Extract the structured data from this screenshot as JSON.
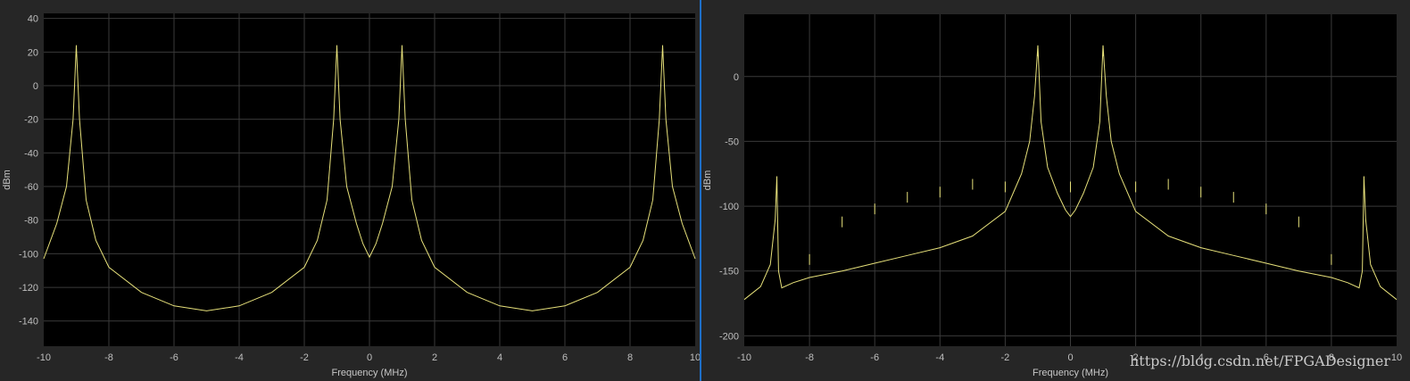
{
  "watermark": "https://blog.csdn.net/FPGADesigner",
  "colors": {
    "background": "#262626",
    "plot_background": "#000000",
    "trace": "#e6e07a",
    "grid": "#3a3a3a",
    "tick_text": "#bfbfbf",
    "divider": "#1e6fc8"
  },
  "chart_data": [
    {
      "type": "line",
      "xlabel": "Frequency (MHz)",
      "ylabel": "dBm",
      "xlim": [
        -10,
        10
      ],
      "ylim": [
        -155,
        43
      ],
      "xticks": [
        -10,
        -8,
        -6,
        -4,
        -2,
        0,
        2,
        4,
        6,
        8,
        10
      ],
      "yticks": [
        40,
        20,
        0,
        -20,
        -40,
        -60,
        -80,
        -100,
        -120,
        -140
      ],
      "grid": true,
      "floor": -134,
      "peaks": [
        {
          "x": -9,
          "y": 24
        },
        {
          "x": -1,
          "y": 24
        },
        {
          "x": 1,
          "y": 24
        },
        {
          "x": 9,
          "y": 24
        }
      ],
      "series": [
        {
          "x": [
            -10,
            -9.6,
            -9.3,
            -9.1,
            -9,
            -8.9,
            -8.7,
            -8.4,
            -8,
            -7,
            -6,
            -5,
            -4,
            -3,
            -2,
            -1.6,
            -1.3,
            -1.1,
            -1,
            -0.9,
            -0.7,
            -0.4,
            -0.2,
            0,
            0.2,
            0.4,
            0.7,
            0.9,
            1,
            1.1,
            1.3,
            1.6,
            2,
            3,
            4,
            5,
            6,
            7,
            8,
            8.4,
            8.7,
            8.9,
            9,
            9.1,
            9.3,
            9.6,
            10
          ],
          "values": [
            -103,
            -82,
            -60,
            -20,
            24,
            -20,
            -68,
            -92,
            -108,
            -123,
            -131,
            -134,
            -131,
            -123,
            -108,
            -92,
            -68,
            -20,
            24,
            -20,
            -60,
            -82,
            -94,
            -102,
            -94,
            -82,
            -60,
            -20,
            24,
            -20,
            -68,
            -92,
            -108,
            -123,
            -131,
            -134,
            -131,
            -123,
            -108,
            -92,
            -68,
            -20,
            24,
            -20,
            -60,
            -82,
            -103
          ]
        }
      ]
    },
    {
      "type": "line",
      "xlabel": "Frequency (MHz)",
      "ylabel": "dBm",
      "xlim": [
        -10,
        10
      ],
      "ylim": [
        -208,
        48
      ],
      "xticks": [
        -10,
        -8,
        -6,
        -4,
        -2,
        0,
        2,
        4,
        6,
        8,
        10
      ],
      "yticks": [
        0,
        -50,
        -100,
        -150,
        -200
      ],
      "grid": true,
      "peaks": [
        {
          "x": -9,
          "y": -77
        },
        {
          "x": -8,
          "y": -137
        },
        {
          "x": -7,
          "y": -108
        },
        {
          "x": -6,
          "y": -98
        },
        {
          "x": -5,
          "y": -89
        },
        {
          "x": -4,
          "y": -85
        },
        {
          "x": -3,
          "y": -79
        },
        {
          "x": -2,
          "y": -81
        },
        {
          "x": -1,
          "y": 24
        },
        {
          "x": 0,
          "y": -81
        },
        {
          "x": 1,
          "y": 24
        },
        {
          "x": 2,
          "y": -81
        },
        {
          "x": 3,
          "y": -79
        },
        {
          "x": 4,
          "y": -85
        },
        {
          "x": 5,
          "y": -89
        },
        {
          "x": 6,
          "y": -98
        },
        {
          "x": 7,
          "y": -108
        },
        {
          "x": 8,
          "y": -137
        },
        {
          "x": 9,
          "y": -77
        }
      ],
      "series": [
        {
          "x": [
            -10,
            -9.5,
            -9.2,
            -9.05,
            -9,
            -8.95,
            -8.85,
            -8.5,
            -8,
            -7,
            -6,
            -5,
            -4,
            -3,
            -2,
            -1.5,
            -1.25,
            -1.1,
            -1,
            -0.9,
            -0.7,
            -0.4,
            -0.15,
            0,
            0.15,
            0.4,
            0.7,
            0.9,
            1,
            1.1,
            1.25,
            1.5,
            2,
            3,
            4,
            5,
            6,
            7,
            8,
            8.5,
            8.85,
            8.95,
            9,
            9.05,
            9.2,
            9.5,
            10
          ],
          "values": [
            -172,
            -162,
            -145,
            -110,
            -77,
            -150,
            -163,
            -159,
            -155,
            -150,
            -144,
            -138,
            -132,
            -123,
            -104,
            -75,
            -50,
            -15,
            24,
            -35,
            -70,
            -90,
            -103,
            -108,
            -103,
            -90,
            -70,
            -35,
            24,
            -15,
            -50,
            -75,
            -104,
            -123,
            -132,
            -138,
            -144,
            -150,
            -155,
            -159,
            -163,
            -150,
            -77,
            -110,
            -145,
            -162,
            -172
          ]
        }
      ]
    }
  ]
}
